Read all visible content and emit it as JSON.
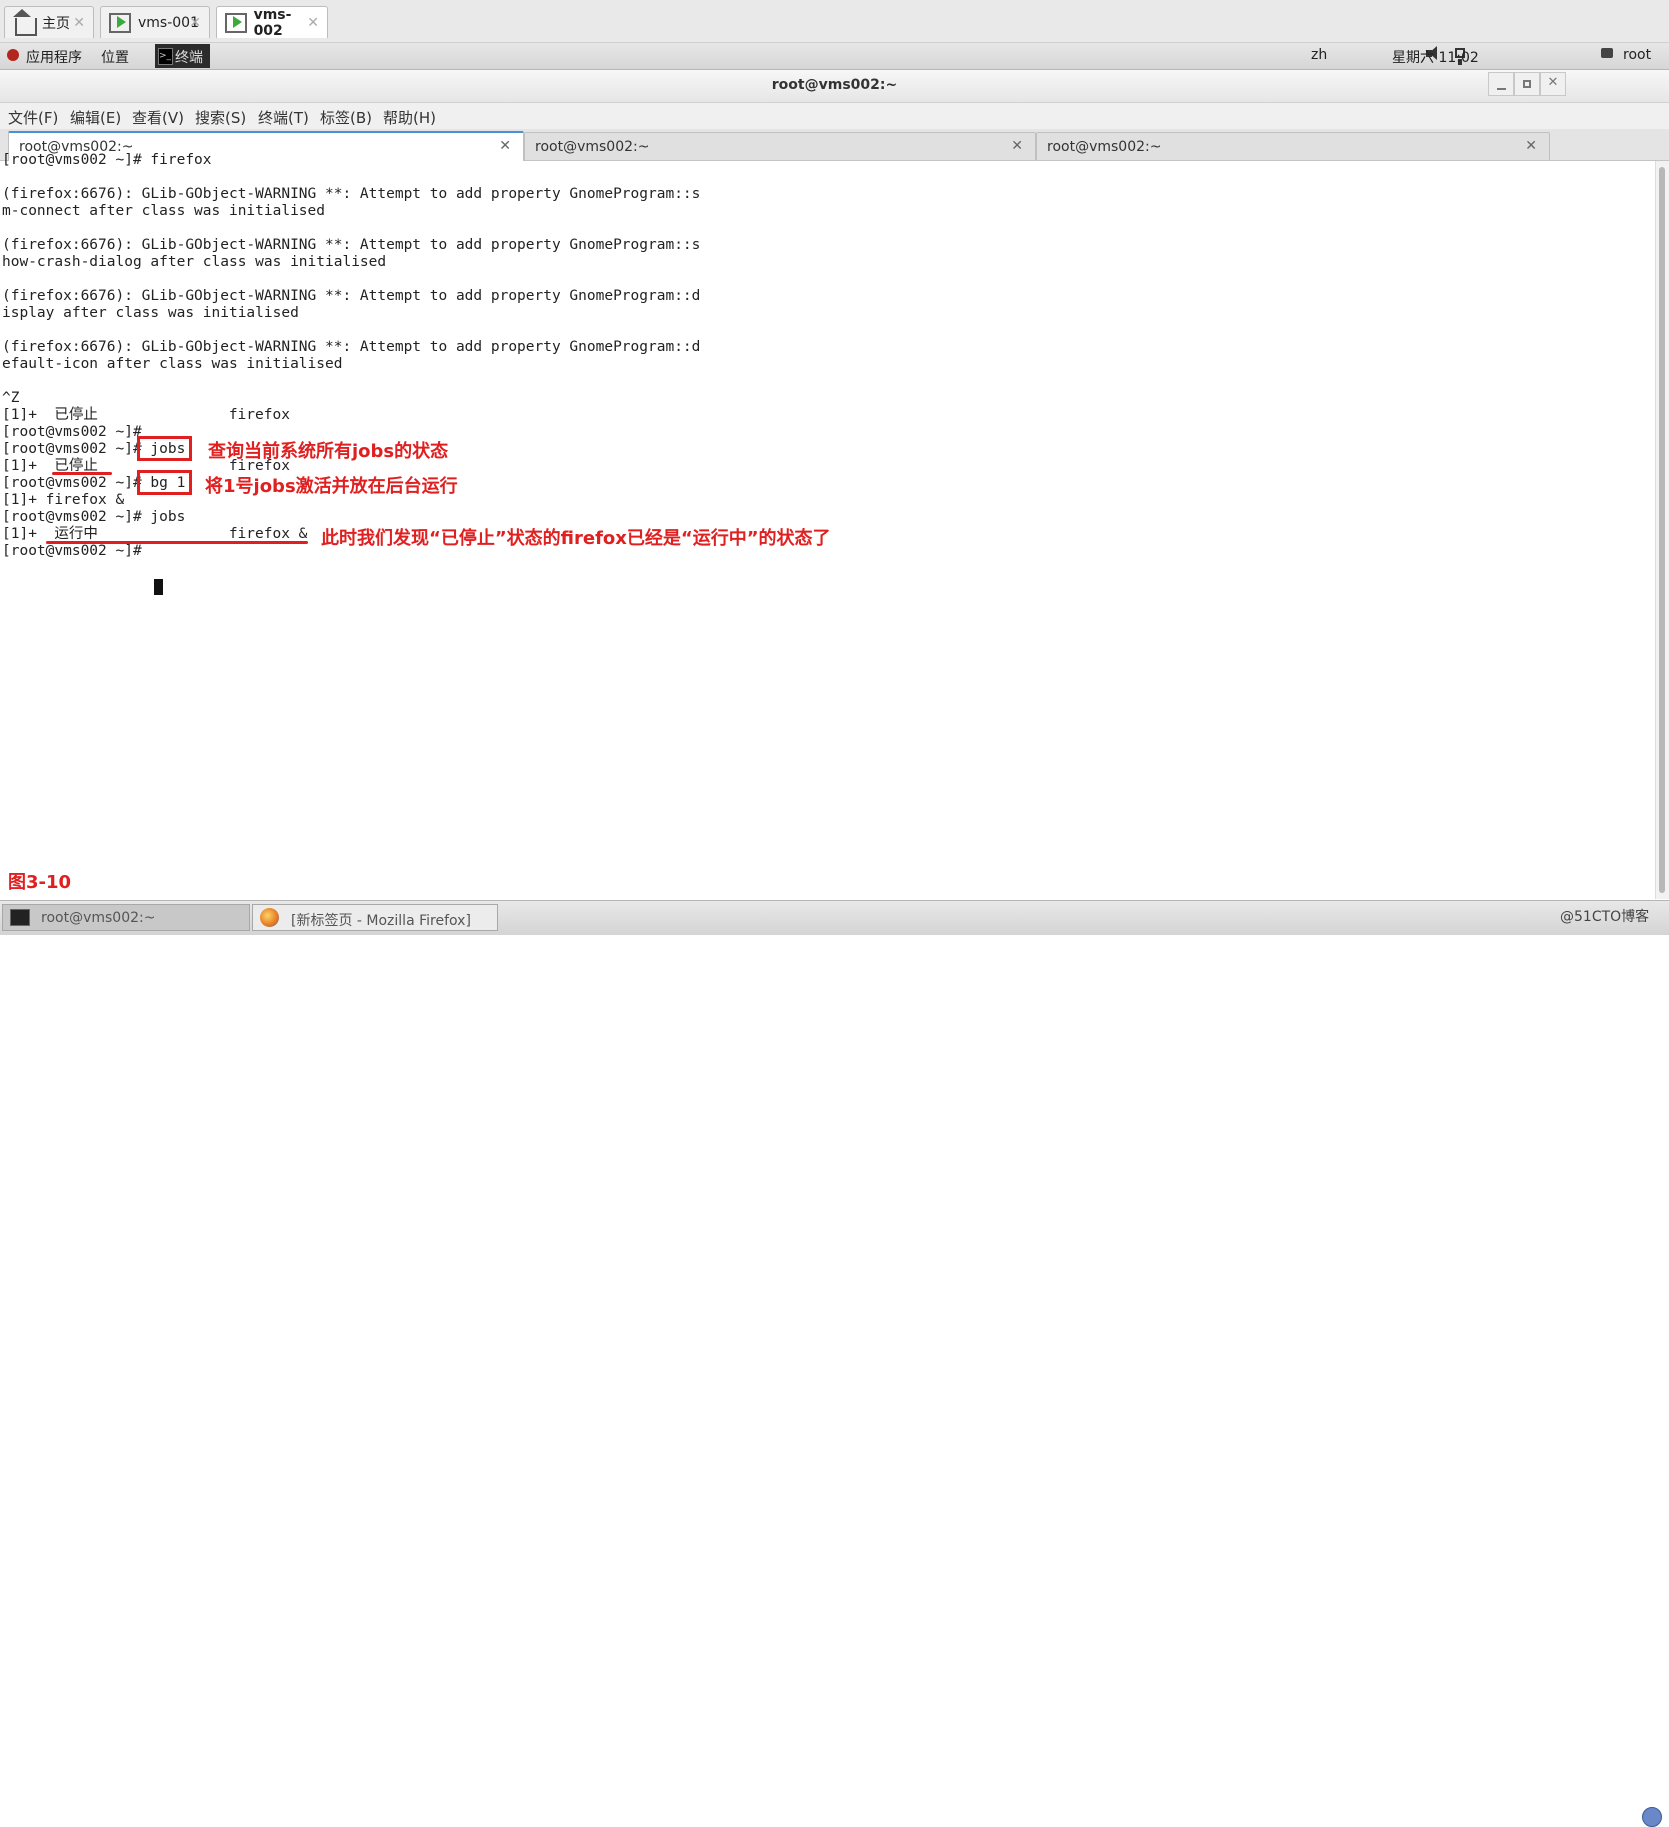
{
  "vm_tabs": [
    {
      "label": "主页",
      "icon": "home-icon"
    },
    {
      "label": "vms-001",
      "icon": "vm-icon"
    },
    {
      "label": "vms-002",
      "icon": "vm-icon",
      "active": true
    }
  ],
  "panel": {
    "applications": "应用程序",
    "places": "位置",
    "terminal_launcher": "终端",
    "lang": "zh",
    "datetime": "星期六 11:02",
    "user": "root"
  },
  "window": {
    "title": "root@vms002:~"
  },
  "menu": [
    "文件(F)",
    "编辑(E)",
    "查看(V)",
    "搜索(S)",
    "终端(T)",
    "标签(B)",
    "帮助(H)"
  ],
  "terminal_tabs": [
    {
      "label": "root@vms002:~",
      "active": true
    },
    {
      "label": "root@vms002:~"
    },
    {
      "label": "root@vms002:~"
    }
  ],
  "terminal_lines": [
    "[root@vms002 ~]# firefox",
    "",
    "(firefox:6676): GLib-GObject-WARNING **: Attempt to add property GnomeProgram::s",
    "m-connect after class was initialised",
    "",
    "(firefox:6676): GLib-GObject-WARNING **: Attempt to add property GnomeProgram::s",
    "how-crash-dialog after class was initialised",
    "",
    "(firefox:6676): GLib-GObject-WARNING **: Attempt to add property GnomeProgram::d",
    "isplay after class was initialised",
    "",
    "(firefox:6676): GLib-GObject-WARNING **: Attempt to add property GnomeProgram::d",
    "efault-icon after class was initialised",
    "",
    "^Z",
    "[1]+  已停止               firefox",
    "[root@vms002 ~]#",
    "[root@vms002 ~]# jobs",
    "[1]+  已停止               firefox",
    "[root@vms002 ~]# bg 1",
    "[1]+ firefox &",
    "[root@vms002 ~]# jobs",
    "[1]+  运行中               firefox &",
    "[root@vms002 ~]# "
  ],
  "annotations": {
    "jobs_note": "查询当前系统所有jobs的状态",
    "bg_note": "将1号jobs激活并放在后台运行",
    "running_note": "此时我们发现“已停止”状态的firefox已经是“运行中”的状态了",
    "figure_label": "图3-10"
  },
  "taskbar": [
    {
      "label": "root@vms002:~",
      "active": true
    },
    {
      "label": "[新标签页 - Mozilla Firefox]"
    }
  ],
  "watermark": "@51CTO博客",
  "colors": {
    "annotation": "#e02020",
    "terminal_bg": "#ffffff",
    "tab_accent": "#4a90d9"
  }
}
